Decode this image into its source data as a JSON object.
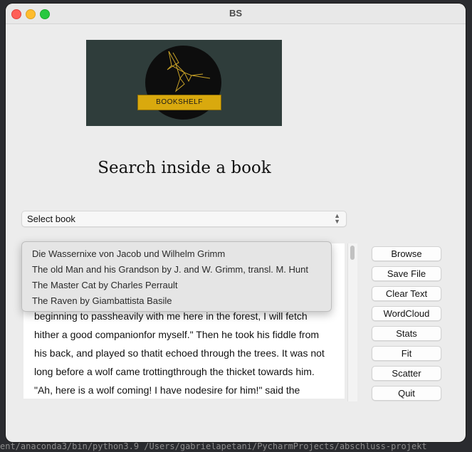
{
  "window": {
    "title": "BS"
  },
  "logo": {
    "banner_text": "BOOKSHELF"
  },
  "heading": "Search inside a book",
  "book_select": {
    "value": "Select book"
  },
  "dropdown_options": [
    "Die Wassernixe von Jacob und Wilhelm Grimm",
    "The old Man and his Grandson by J. and W. Grimm, transl. M. Hunt",
    "The Master Cat by Charles Perrault",
    "The Raven by Giambattista Basile"
  ],
  "text_lines": [
    "beginning to passheavily with me here in the forest, I will fetch",
    "hither a good companionfor myself.\" Then he took his fiddle from",
    "his back, and played so thatit echoed through the trees. It was not",
    "long before a wolf came trottingthrough the thicket towards him.",
    "\"Ah, here is a wolf coming! I have nodesire for him!\" said the"
  ],
  "buttons": [
    "Browse",
    "Save File",
    "Clear Text",
    "WordCloud",
    "Stats",
    "Fit",
    "Scatter",
    "Quit"
  ],
  "background_terminal": "ent/anaconda3/bin/python3.9 /Users/gabrielapetani/PycharmProjects/abschluss-projekt"
}
